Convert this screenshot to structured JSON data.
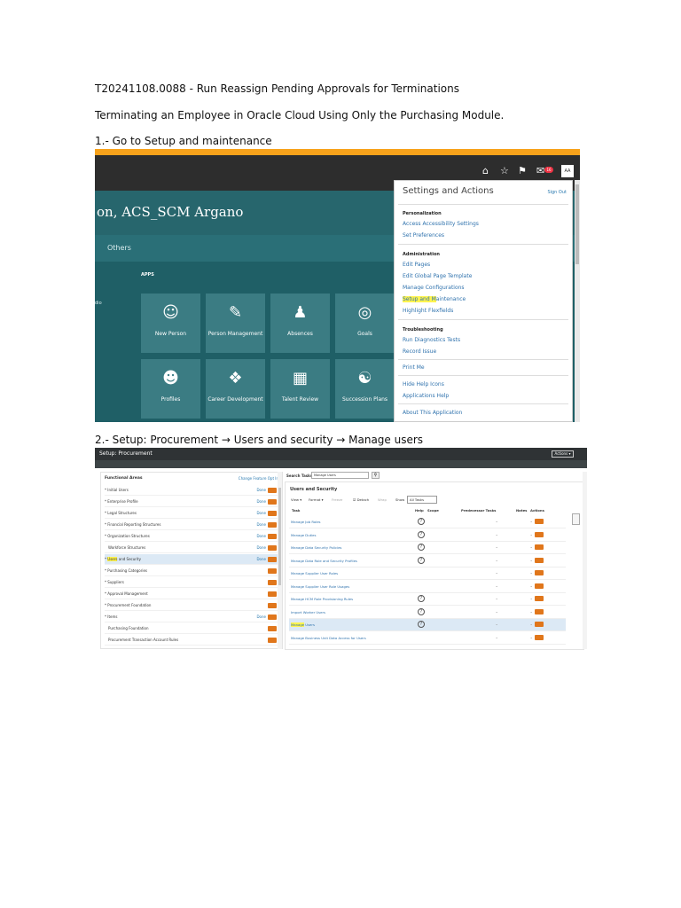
{
  "document": {
    "title_line": "T20241108.0088 - Run Reassign Pending Approvals for Terminations",
    "intro_line": "Terminating an Employee in Oracle Cloud Using Only the Purchasing Module.",
    "step1_heading": "1.- Go to Setup and maintenance",
    "step2_heading": "2.- Setup: Procurement → Users and security → Manage users"
  },
  "screenshot1": {
    "user_name": "on, ACS_SCM Argano",
    "tab_others": "Others",
    "apps_label": "APPS",
    "left_cut_text": "dio",
    "notification_count": "16",
    "avatar_initials": "AA",
    "tiles": [
      {
        "label": "New Person",
        "icon": "person-add-icon"
      },
      {
        "label": "Person Management",
        "icon": "person-edit-icon"
      },
      {
        "label": "Absences",
        "icon": "person-icon"
      },
      {
        "label": "Goals",
        "icon": "goals-icon"
      },
      {
        "label": "Profiles",
        "icon": "profile-icon"
      },
      {
        "label": "Career Development",
        "icon": "signpost-icon"
      },
      {
        "label": "Talent Review",
        "icon": "talent-review-icon"
      },
      {
        "label": "Succession Plans",
        "icon": "succession-icon"
      }
    ],
    "panel": {
      "title": "Settings and Actions",
      "sign_out": "Sign Out",
      "sections": {
        "personalization": "Personalization",
        "administration": "Administration",
        "troubleshooting": "Troubleshooting"
      },
      "items": {
        "access_accessibility": "Access Accessibility Settings",
        "set_preferences": "Set Preferences",
        "edit_pages": "Edit Pages",
        "edit_global_page_template": "Edit Global Page Template",
        "manage_configurations": "Manage Configurations",
        "setup_highlight": "Setup and M",
        "setup_rest": "aintenance",
        "highlight_flexfields": "Highlight Flexfields",
        "run_diagnostics": "Run Diagnostics Tests",
        "record_issue": "Record Issue",
        "print_me": "Print Me",
        "hide_help_icons": "Hide Help Icons",
        "applications_help": "Applications Help",
        "about_application": "About This Application"
      }
    }
  },
  "screenshot2": {
    "header_title": "Setup: Procurement",
    "actions_label": "Actions",
    "functional_areas_title": "Functional Areas",
    "change_feature_optin": "Change Feature Opt In",
    "functional_areas": [
      {
        "label": "Initial Users",
        "required": true,
        "done": "Done",
        "selected": false
      },
      {
        "label": "Enterprise Profile",
        "required": true,
        "done": "Done",
        "selected": false
      },
      {
        "label": "Legal Structures",
        "required": true,
        "done": "Done",
        "selected": false
      },
      {
        "label": "Financial Reporting Structures",
        "required": true,
        "done": "Done",
        "selected": false
      },
      {
        "label": "Organization Structures",
        "required": true,
        "done": "Done",
        "selected": false
      },
      {
        "label": "Workforce Structures",
        "required": false,
        "done": "Done",
        "selected": false
      },
      {
        "label_hl": "Users",
        "label": " and Security",
        "required": true,
        "done": "Done",
        "selected": true
      },
      {
        "label": "Purchasing Categories",
        "required": true,
        "done": "",
        "selected": false
      },
      {
        "label": "Suppliers",
        "required": true,
        "done": "",
        "selected": false
      },
      {
        "label": "Approval Management",
        "required": true,
        "done": "",
        "selected": false
      },
      {
        "label": "Procurement Foundation",
        "required": true,
        "done": "",
        "selected": false
      },
      {
        "label": "Items",
        "required": true,
        "done": "Done",
        "selected": false
      },
      {
        "label": "Purchasing Foundation",
        "required": false,
        "done": "",
        "selected": false
      },
      {
        "label": "Procurement Transaction Account Rules",
        "required": false,
        "done": "",
        "selected": false
      }
    ],
    "search_tasks_label": "Search Tasks",
    "search_tasks_value": "Manage Users",
    "section_title": "Users and Security",
    "toolbar": {
      "view": "View ▾",
      "format": "Format ▾",
      "freeze": "Freeze",
      "detach": "Detach",
      "wrap": "Wrap",
      "show_label": "Show",
      "show_value": "All Tasks"
    },
    "columns": {
      "task": "Task",
      "help": "Help",
      "scope": "Scope",
      "predecessor": "Predecessor Tasks",
      "notes": "Notes",
      "actions": "Actions"
    },
    "tasks": [
      {
        "name": "Manage Job Roles",
        "help": true,
        "selected": false
      },
      {
        "name": "Manage Duties",
        "help": true,
        "selected": false
      },
      {
        "name": "Manage Data Security Policies",
        "help": true,
        "selected": false
      },
      {
        "name": "Manage Data Role and Security Profiles",
        "help": true,
        "selected": false
      },
      {
        "name": "Manage Supplier User Roles",
        "help": false,
        "selected": false
      },
      {
        "name": "Manage Supplier User Role Usages",
        "help": false,
        "selected": false
      },
      {
        "name": "Manage HCM Role Provisioning Rules",
        "help": true,
        "selected": false
      },
      {
        "name": "Import Worker Users",
        "help": true,
        "selected": false
      },
      {
        "name_hl": "Manage",
        "name": " Users",
        "help": true,
        "selected": true
      },
      {
        "name": "Manage Business Unit Data Access for Users",
        "help": false,
        "selected": false
      }
    ]
  }
}
